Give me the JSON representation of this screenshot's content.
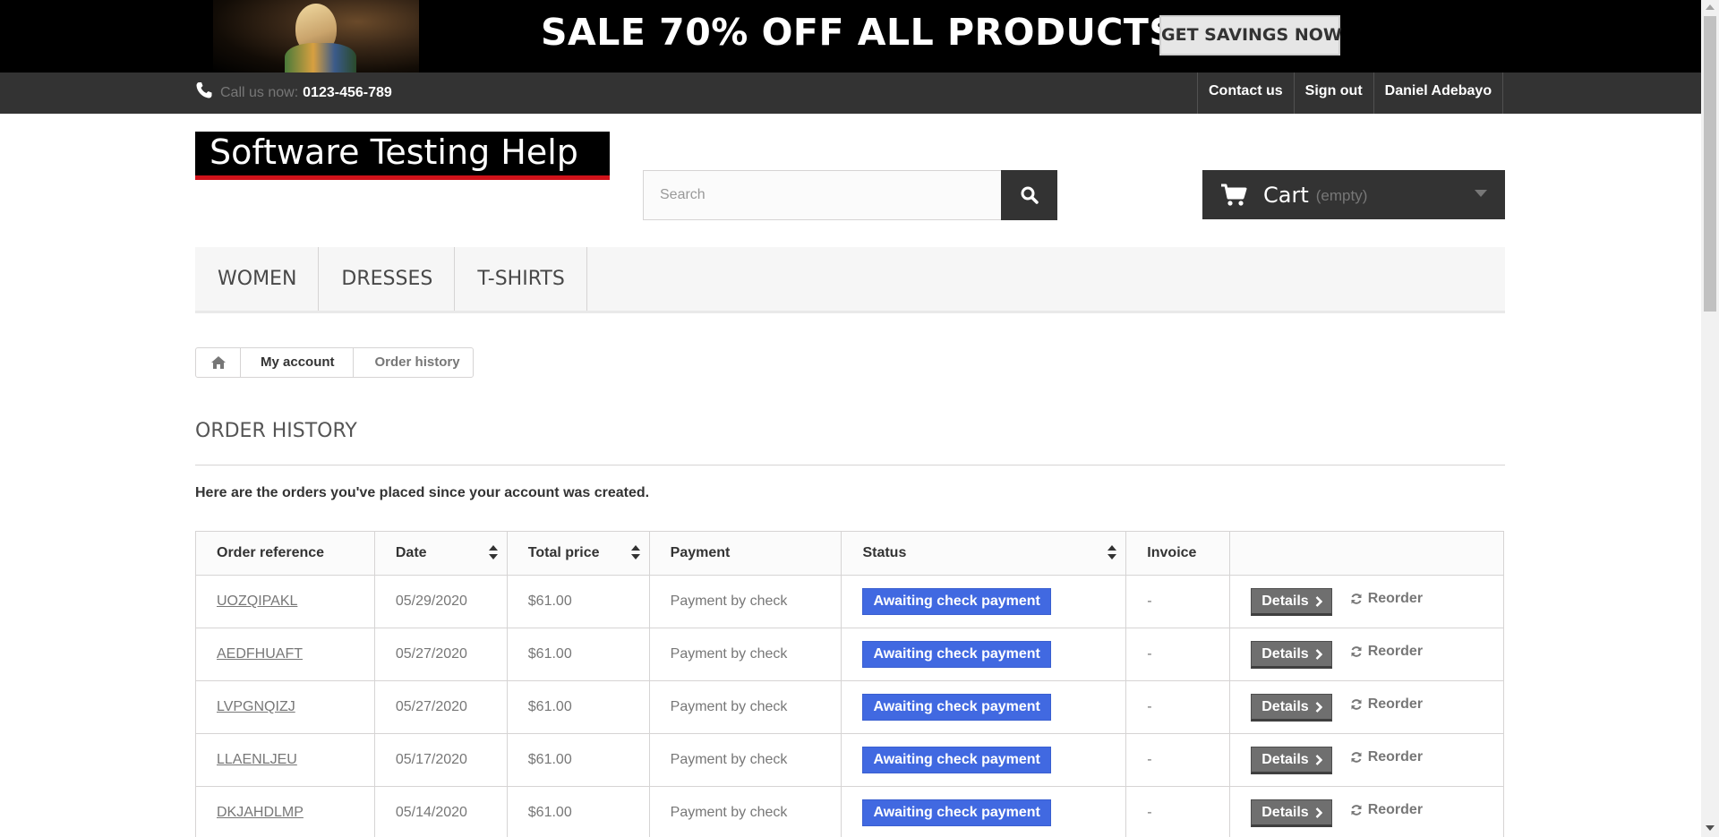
{
  "banner": {
    "headline": "SALE 70% OFF ALL PRODUCTS",
    "cta": "GET SAVINGS NOW"
  },
  "topbar": {
    "call_label": "Call us now:",
    "phone": "0123-456-789",
    "links": [
      "Contact us",
      "Sign out",
      "Daniel Adebayo"
    ]
  },
  "header": {
    "logo_text": "Software Testing Help",
    "search_placeholder": "Search",
    "cart_label": "Cart",
    "cart_status": "(empty)"
  },
  "menu": {
    "items": [
      "WOMEN",
      "DRESSES",
      "T-SHIRTS"
    ]
  },
  "breadcrumb": {
    "home_icon": "home-icon",
    "items": [
      "My account",
      "Order history"
    ]
  },
  "page": {
    "title": "ORDER HISTORY",
    "intro": "Here are the orders you've placed since your account was created."
  },
  "table": {
    "columns": [
      "Order reference",
      "Date",
      "Total price",
      "Payment",
      "Status",
      "Invoice",
      ""
    ],
    "status_color": "#4169e1",
    "details_label": "Details",
    "reorder_label": "Reorder",
    "rows": [
      {
        "reference": "UOZQIPAKL",
        "date": "05/29/2020",
        "total": "$61.00",
        "payment": "Payment by check",
        "status": "Awaiting check payment",
        "invoice": "-"
      },
      {
        "reference": "AEDFHUAFT",
        "date": "05/27/2020",
        "total": "$61.00",
        "payment": "Payment by check",
        "status": "Awaiting check payment",
        "invoice": "-"
      },
      {
        "reference": "LVPGNQIZJ",
        "date": "05/27/2020",
        "total": "$61.00",
        "payment": "Payment by check",
        "status": "Awaiting check payment",
        "invoice": "-"
      },
      {
        "reference": "LLAENLJEU",
        "date": "05/17/2020",
        "total": "$61.00",
        "payment": "Payment by check",
        "status": "Awaiting check payment",
        "invoice": "-"
      },
      {
        "reference": "DKJAHDLMP",
        "date": "05/14/2020",
        "total": "$61.00",
        "payment": "Payment by check",
        "status": "Awaiting check payment",
        "invoice": "-"
      }
    ]
  }
}
